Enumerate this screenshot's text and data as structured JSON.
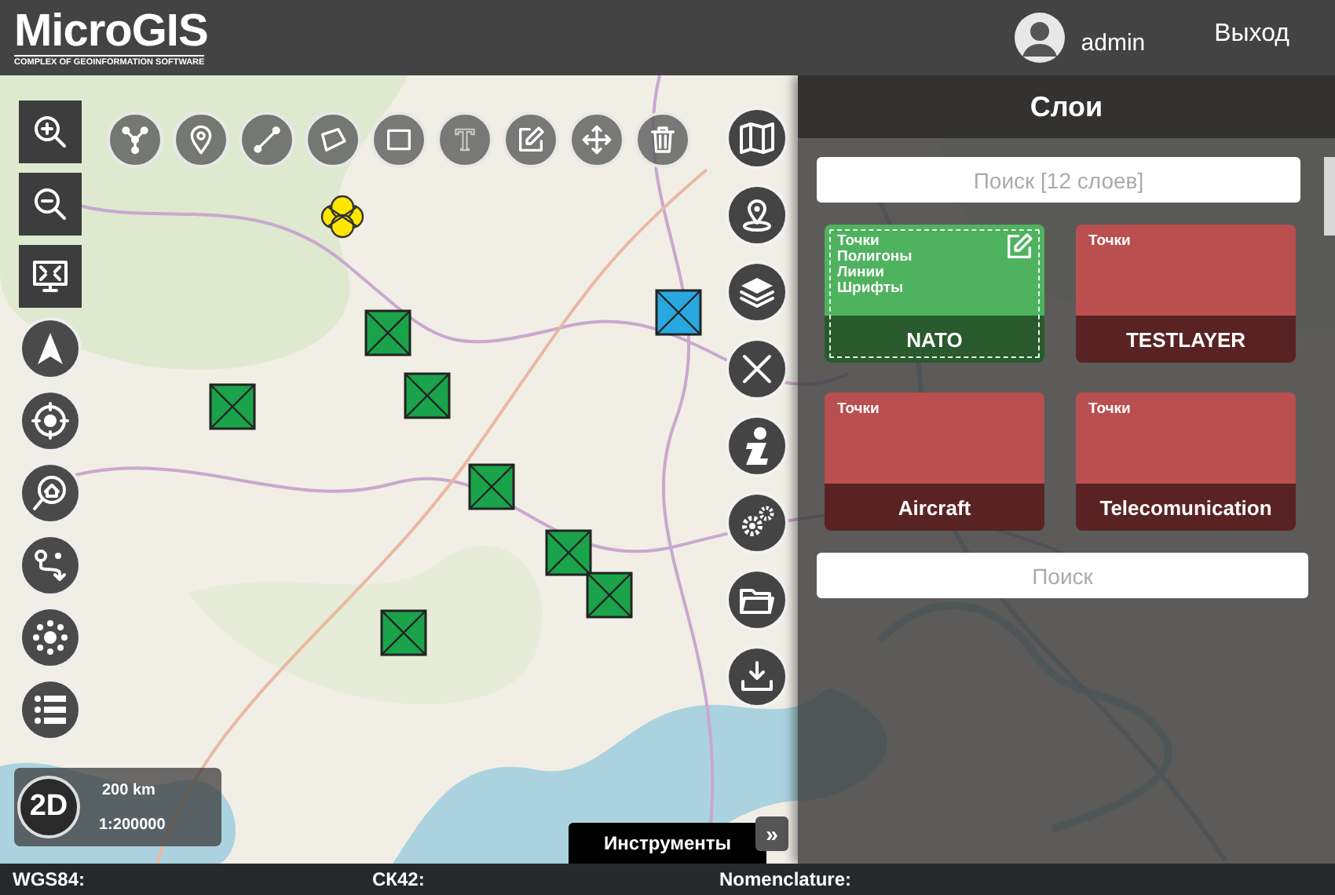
{
  "header": {
    "logo": "MicroGIS",
    "tagline": "COMPLEX OF GEOINFORMATION SOFTWARE",
    "user": "admin",
    "logout": "Выход"
  },
  "scale": {
    "mode": "2D",
    "distance": "200 km",
    "ratio": "1:200000"
  },
  "tools_tab": {
    "label": "Инструменты",
    "expand": "»"
  },
  "layers_panel": {
    "title": "Слои",
    "search": {
      "placeholder": "Поиск [12 слоев]"
    },
    "layers": [
      {
        "name": "NATO",
        "types": [
          "Точки",
          "Полигоны",
          "Линии",
          "Шрифты"
        ],
        "selected": true
      },
      {
        "name": "TESTLAYER",
        "types": [
          "Точки"
        ],
        "selected": false
      },
      {
        "name": "Aircraft",
        "types": [
          "Точки"
        ],
        "selected": false
      },
      {
        "name": "Telecomunication",
        "types": [
          "Точки"
        ],
        "selected": false
      }
    ],
    "bottom_search": {
      "placeholder": "Поиск"
    }
  },
  "status_bar": [
    {
      "label": "WGS84:"
    },
    {
      "label": "СК42:"
    },
    {
      "label": "Nomenclature:"
    }
  ]
}
